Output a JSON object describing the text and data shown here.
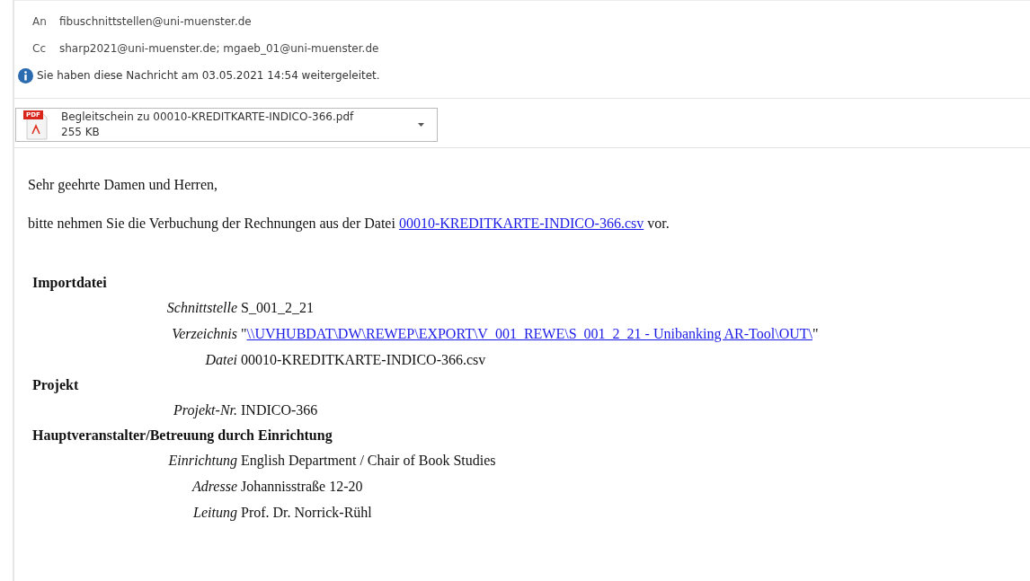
{
  "header": {
    "to": {
      "label": "An",
      "value": "fibuschnittstellen@uni-muenster.de"
    },
    "cc": {
      "label": "Cc",
      "value": "sharp2021@uni-muenster.de; mgaeb_01@uni-muenster.de"
    },
    "info": "Sie haben diese Nachricht am 03.05.2021 14:54 weitergeleitet."
  },
  "attachment": {
    "name": "Begleitschein zu 00010-KREDITKARTE-INDICO-366.pdf",
    "size": "255 KB",
    "type_label": "PDF"
  },
  "body": {
    "greeting": "Sehr geehrte Damen und Herren,",
    "sentence": [
      {
        "kind": "text",
        "text": "bitte nehmen Sie die Verbuchung der Rechnungen aus der Datei "
      },
      {
        "kind": "link",
        "text": "00010-KREDITKARTE-INDICO-366.csv"
      },
      {
        "kind": "text",
        "text": " vor."
      }
    ],
    "sections": [
      {
        "heading": "Importdatei",
        "fields": [
          {
            "label": "Schnittstelle",
            "parts": [
              {
                "kind": "text",
                "text": "S_001_2_21"
              }
            ]
          },
          {
            "label": "Verzeichnis",
            "parts": [
              {
                "kind": "text",
                "text": "\""
              },
              {
                "kind": "link",
                "text": "\\\\UVHUBDAT\\DW\\REWEP\\EXPORT\\V_001_REWE\\S_001_2_21 - Unibanking AR-Tool\\OUT\\"
              },
              {
                "kind": "text",
                "text": "\""
              }
            ]
          },
          {
            "label": "Datei",
            "parts": [
              {
                "kind": "text",
                "text": "00010-KREDITKARTE-INDICO-366.csv"
              }
            ]
          }
        ]
      },
      {
        "heading": "Projekt",
        "fields": [
          {
            "label": "Projekt-Nr.",
            "parts": [
              {
                "kind": "text",
                "text": "INDICO-366"
              }
            ]
          }
        ]
      },
      {
        "heading": "Hauptveranstalter/Betreuung durch Einrichtung",
        "fields": [
          {
            "label": "Einrichtung",
            "parts": [
              {
                "kind": "text",
                "text": "English Department / Chair of Book Studies"
              }
            ]
          },
          {
            "label": "Adresse",
            "parts": [
              {
                "kind": "text",
                "text": "Johannisstraße 12-20"
              }
            ]
          },
          {
            "label": "Leitung",
            "parts": [
              {
                "kind": "text",
                "text": "Prof. Dr. Norrick-Rühl"
              }
            ]
          }
        ]
      }
    ]
  }
}
